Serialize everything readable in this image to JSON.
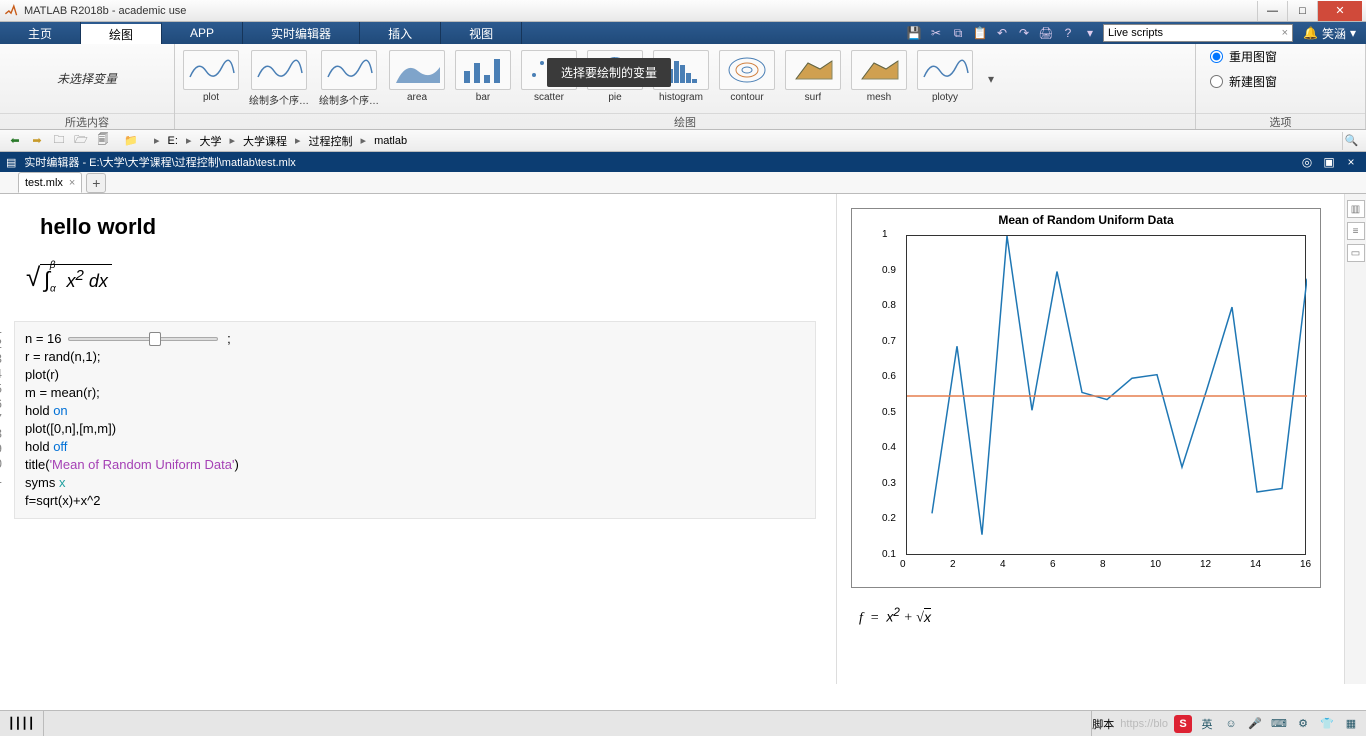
{
  "titlebar": {
    "title": "MATLAB R2018b - academic use"
  },
  "maintabs": {
    "items": [
      "主页",
      "绘图",
      "APP",
      "实时编辑器",
      "插入",
      "视图"
    ],
    "active": 1
  },
  "toolbar_icons": {
    "search_text": "Live scripts",
    "user": "笑涵"
  },
  "toolstrip": {
    "selvar_label": "未选择变量",
    "selvar_footer": "所选内容",
    "plot_footer": "绘图",
    "opt_footer": "选项",
    "tooltip": "选择要绘制的变量",
    "thumbs": [
      "plot",
      "绘制多个序…",
      "绘制多个序…",
      "area",
      "bar",
      "scatter",
      "pie",
      "histogram",
      "contour",
      "surf",
      "mesh",
      "plotyy"
    ],
    "opt_reuse": "重用图窗",
    "opt_new": "新建图窗"
  },
  "breadcrumb": {
    "drive": "E:",
    "parts": [
      "大学",
      "大学课程",
      "过程控制",
      "matlab"
    ]
  },
  "docbar": {
    "label": "实时编辑器 - E:\\大学\\大学课程\\过程控制\\matlab\\test.mlx"
  },
  "filetab": {
    "name": "test.mlx"
  },
  "document": {
    "heading": "hello world",
    "math_display": "√(∫αβ x² dx)",
    "code_lines": {
      "l1a": "n =  ",
      "l1b": "16",
      "l1c": " ;",
      "l2": "r = rand(n,1);",
      "l3": "plot(r)",
      "l4": "",
      "l5": "m = mean(r);",
      "l6a": "hold ",
      "l6b": "on",
      "l7": "plot([0,n],[m,m])",
      "l8a": "hold ",
      "l8b": "off",
      "l9a": "title(",
      "l9b": "'Mean of Random Uniform Data'",
      "l9c": ")",
      "l10a": "syms ",
      "l10b": "x",
      "l11": "f=sqrt(x)+x^2"
    }
  },
  "output": {
    "formula": "f  =  x² + √x"
  },
  "chart_data": {
    "type": "line",
    "title": "Mean of Random Uniform Data",
    "xlim": [
      0,
      16
    ],
    "ylim": [
      0.1,
      1.0
    ],
    "xticks": [
      0,
      2,
      4,
      6,
      8,
      10,
      12,
      14,
      16
    ],
    "yticks": [
      0.1,
      0.2,
      0.3,
      0.4,
      0.5,
      0.6,
      0.7,
      0.8,
      0.9,
      1.0
    ],
    "series": [
      {
        "name": "r",
        "x": [
          1,
          2,
          3,
          4,
          5,
          6,
          7,
          8,
          9,
          10,
          11,
          12,
          13,
          14,
          15,
          16
        ],
        "y": [
          0.22,
          0.69,
          0.16,
          1.0,
          0.51,
          0.9,
          0.56,
          0.54,
          0.6,
          0.61,
          0.35,
          0.57,
          0.8,
          0.28,
          0.29,
          0.88
        ]
      },
      {
        "name": "mean",
        "x": [
          0,
          16
        ],
        "y": [
          0.55,
          0.55
        ]
      }
    ]
  },
  "status": {
    "script": "脚本",
    "watermark": "https://blo",
    "ime": "英"
  }
}
